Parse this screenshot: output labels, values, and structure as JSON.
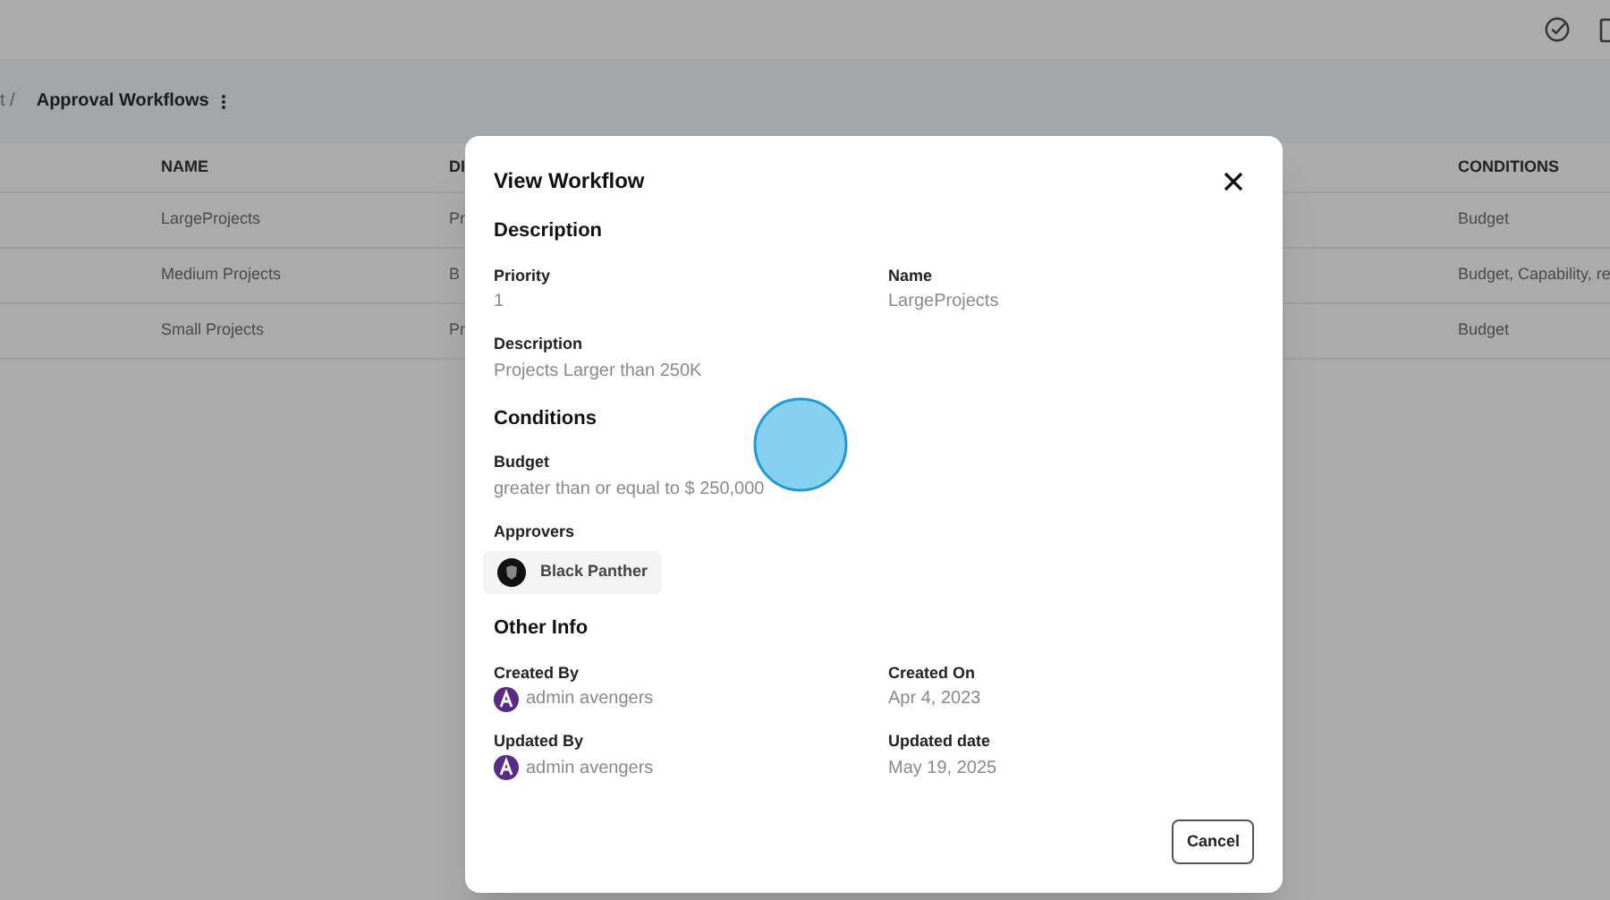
{
  "breadcrumb": {
    "parent": "t /",
    "current": "Approval Workflows"
  },
  "table": {
    "columns": [
      "NAME",
      "DI",
      "CONDITIONS"
    ],
    "rows": [
      [
        "LargeProjects",
        "Pr",
        "Budget"
      ],
      [
        "Medium Projects",
        "B",
        "Budget, Capability, re"
      ],
      [
        "Small Projects",
        "Pr",
        "Budget"
      ]
    ]
  },
  "dialog": {
    "title": "View Workflow",
    "sections": [
      {
        "heading": "Description",
        "fields": [
          {
            "label": "Priority",
            "value": "1"
          },
          {
            "label": "Name",
            "value": "LargeProjects"
          },
          {
            "label": "Description",
            "value": "Projects Larger than 250K",
            "kind": "wide"
          }
        ]
      },
      {
        "heading": "Conditions",
        "fields": [
          {
            "label": "Budget",
            "value": "greater than or equal to $ 250,000",
            "kind": "wide"
          },
          {
            "label": "Approvers",
            "value": "Black Panther",
            "kind": "chip"
          }
        ]
      },
      {
        "heading": "Other Info",
        "fields": [
          {
            "label": "Created By",
            "value": "admin avengers",
            "kind": "user"
          },
          {
            "label": "Created On",
            "value": "Apr 4, 2023"
          },
          {
            "label": "Updated By",
            "value": "admin avengers",
            "kind": "user"
          },
          {
            "label": "Updated date",
            "value": "May 19, 2025"
          }
        ]
      }
    ],
    "cancel": "Cancel"
  }
}
